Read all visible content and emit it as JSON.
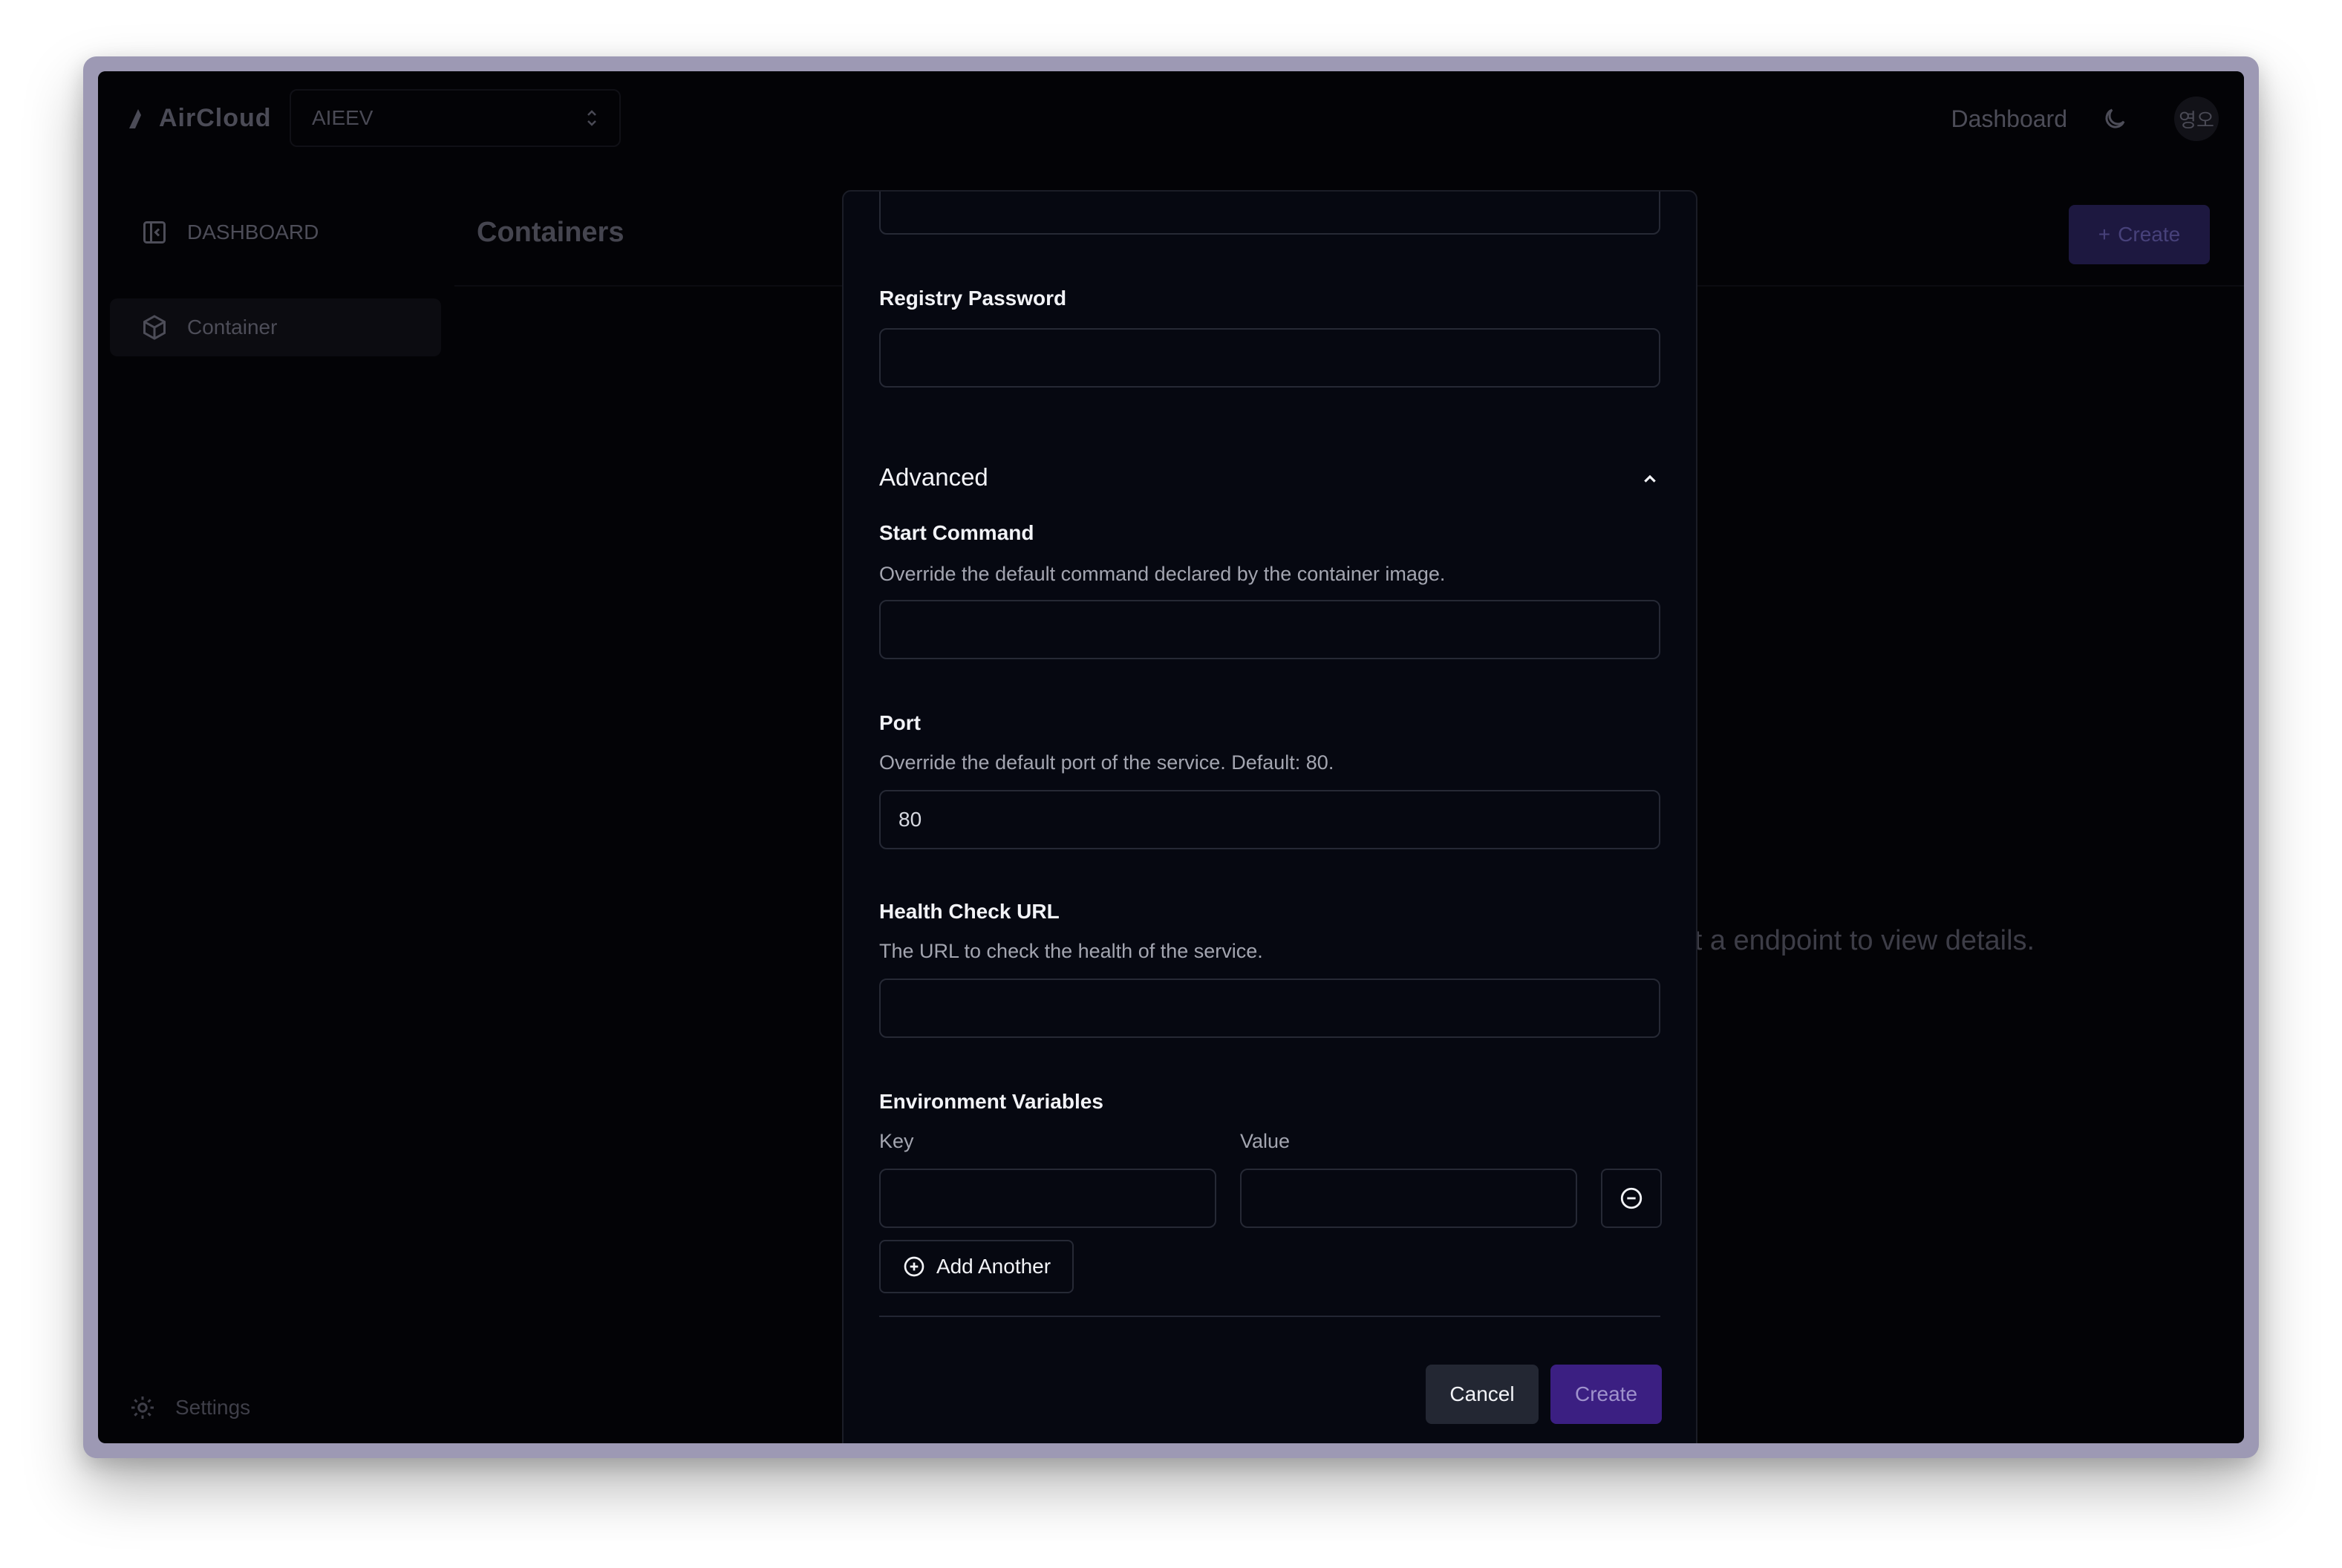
{
  "app": {
    "logo_text": "AirCloud",
    "org_name": "AIEEV",
    "nav_dashboard": "Dashboard",
    "avatar_text": "영오"
  },
  "sidebar": {
    "items": [
      {
        "label": "DASHBOARD",
        "icon": "sidebar-collapse-icon"
      },
      {
        "label": "Container",
        "icon": "box-icon",
        "active": true
      }
    ],
    "settings_label": "Settings"
  },
  "main": {
    "title": "Containers",
    "create_label": "Create",
    "empty_text": "elect a endpoint to view details."
  },
  "modal": {
    "registry_password": {
      "label": "Registry Password",
      "value": ""
    },
    "advanced": {
      "title": "Advanced",
      "expanded": true
    },
    "start_command": {
      "label": "Start Command",
      "description": "Override the default command declared by the container image.",
      "value": ""
    },
    "port": {
      "label": "Port",
      "description": "Override the default port of the service. Default: 80.",
      "value": "80"
    },
    "health_check": {
      "label": "Health Check URL",
      "description": "The URL to check the health of the service.",
      "value": ""
    },
    "env": {
      "label": "Environment Variables",
      "key_label": "Key",
      "value_label": "Value",
      "add_label": "Add Another",
      "rows": [
        {
          "key": "",
          "value": ""
        }
      ]
    },
    "cancel_label": "Cancel",
    "create_label": "Create"
  },
  "colors": {
    "accent": "#3b1f82",
    "modal_bg": "#060811",
    "frame": "#9d99b4"
  }
}
